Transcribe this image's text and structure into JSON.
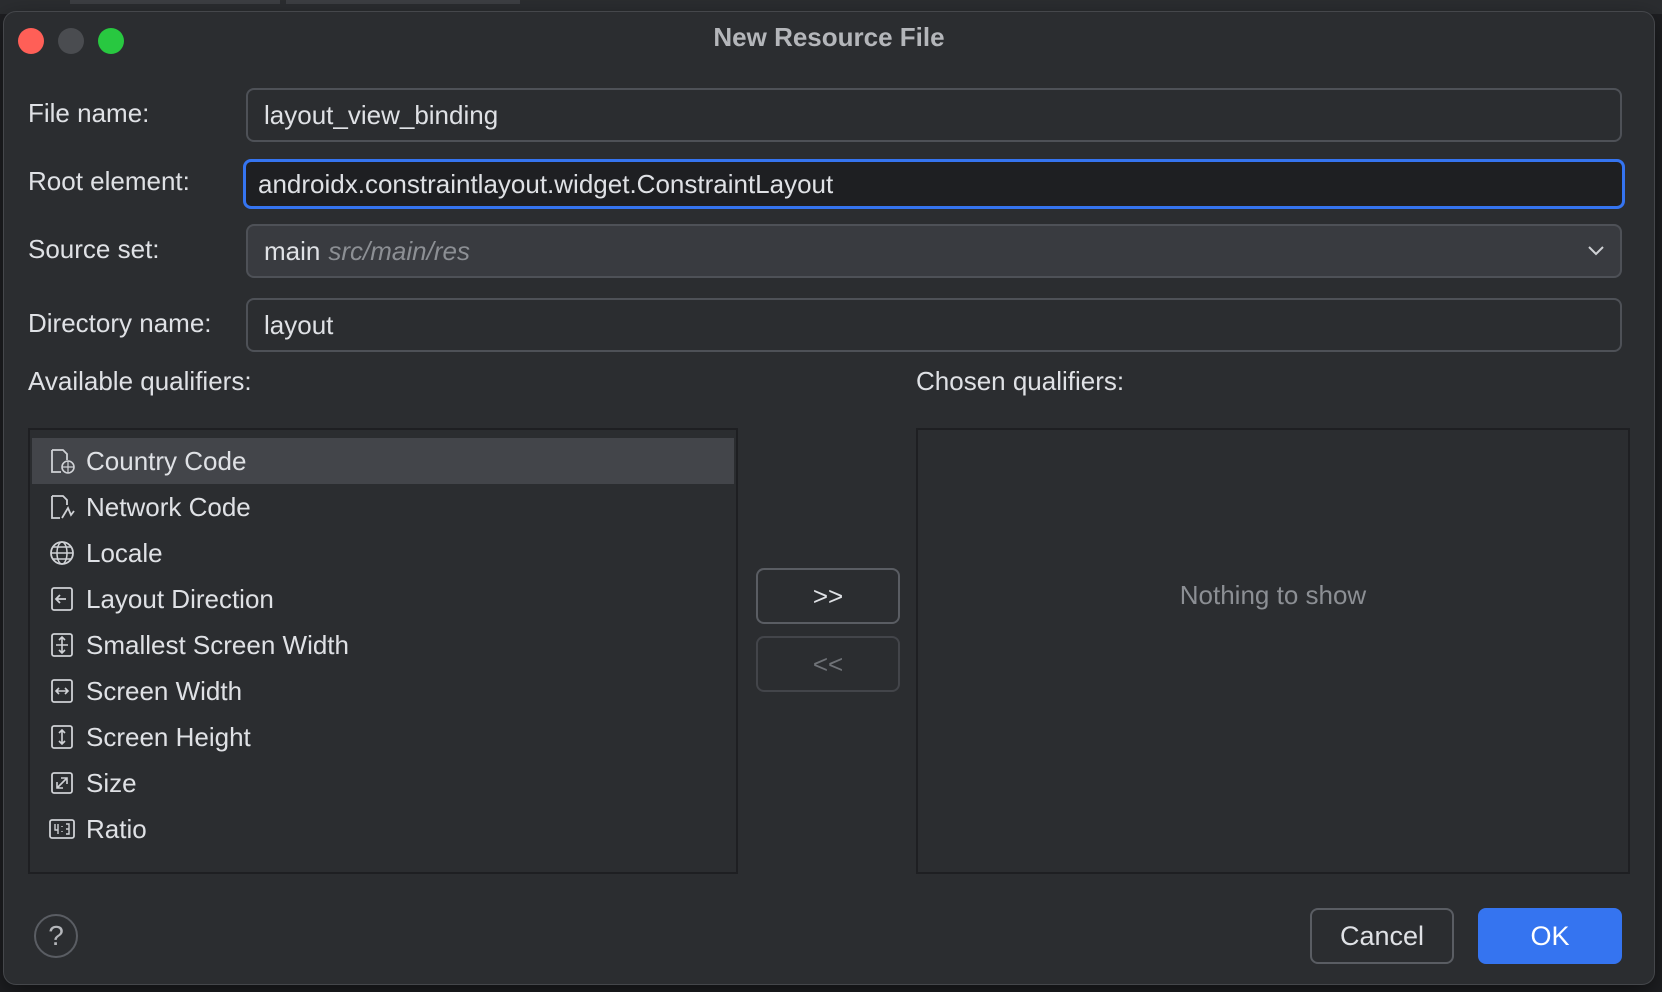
{
  "dialog": {
    "title": "New Resource File"
  },
  "form": {
    "file_name_label": "File name:",
    "file_name_value": "layout_view_binding",
    "root_element_label": "Root element:",
    "root_element_value": "androidx.constraintlayout.widget.ConstraintLayout",
    "source_set_label": "Source set:",
    "source_set_value": "main",
    "source_set_hint": "src/main/res",
    "directory_name_label": "Directory name:",
    "directory_name_value": "layout"
  },
  "qualifiers": {
    "available_label": "Available qualifiers:",
    "chosen_label": "Chosen qualifiers:",
    "empty_text": "Nothing to show",
    "items": [
      {
        "label": "Country Code",
        "icon": "country-code-icon",
        "selected": true
      },
      {
        "label": "Network Code",
        "icon": "network-code-icon",
        "selected": false
      },
      {
        "label": "Locale",
        "icon": "globe-icon",
        "selected": false
      },
      {
        "label": "Layout Direction",
        "icon": "layout-direction-icon",
        "selected": false
      },
      {
        "label": "Smallest Screen Width",
        "icon": "smallest-width-icon",
        "selected": false
      },
      {
        "label": "Screen Width",
        "icon": "screen-width-icon",
        "selected": false
      },
      {
        "label": "Screen Height",
        "icon": "screen-height-icon",
        "selected": false
      },
      {
        "label": "Size",
        "icon": "size-icon",
        "selected": false
      },
      {
        "label": "Ratio",
        "icon": "ratio-icon",
        "selected": false
      }
    ]
  },
  "buttons": {
    "add": ">>",
    "remove": "<<",
    "help": "?",
    "cancel": "Cancel",
    "ok": "OK"
  },
  "colors": {
    "accent": "#3574f0",
    "dialog_bg": "#2b2d30",
    "close": "#ff5f57",
    "zoom": "#28c840"
  }
}
